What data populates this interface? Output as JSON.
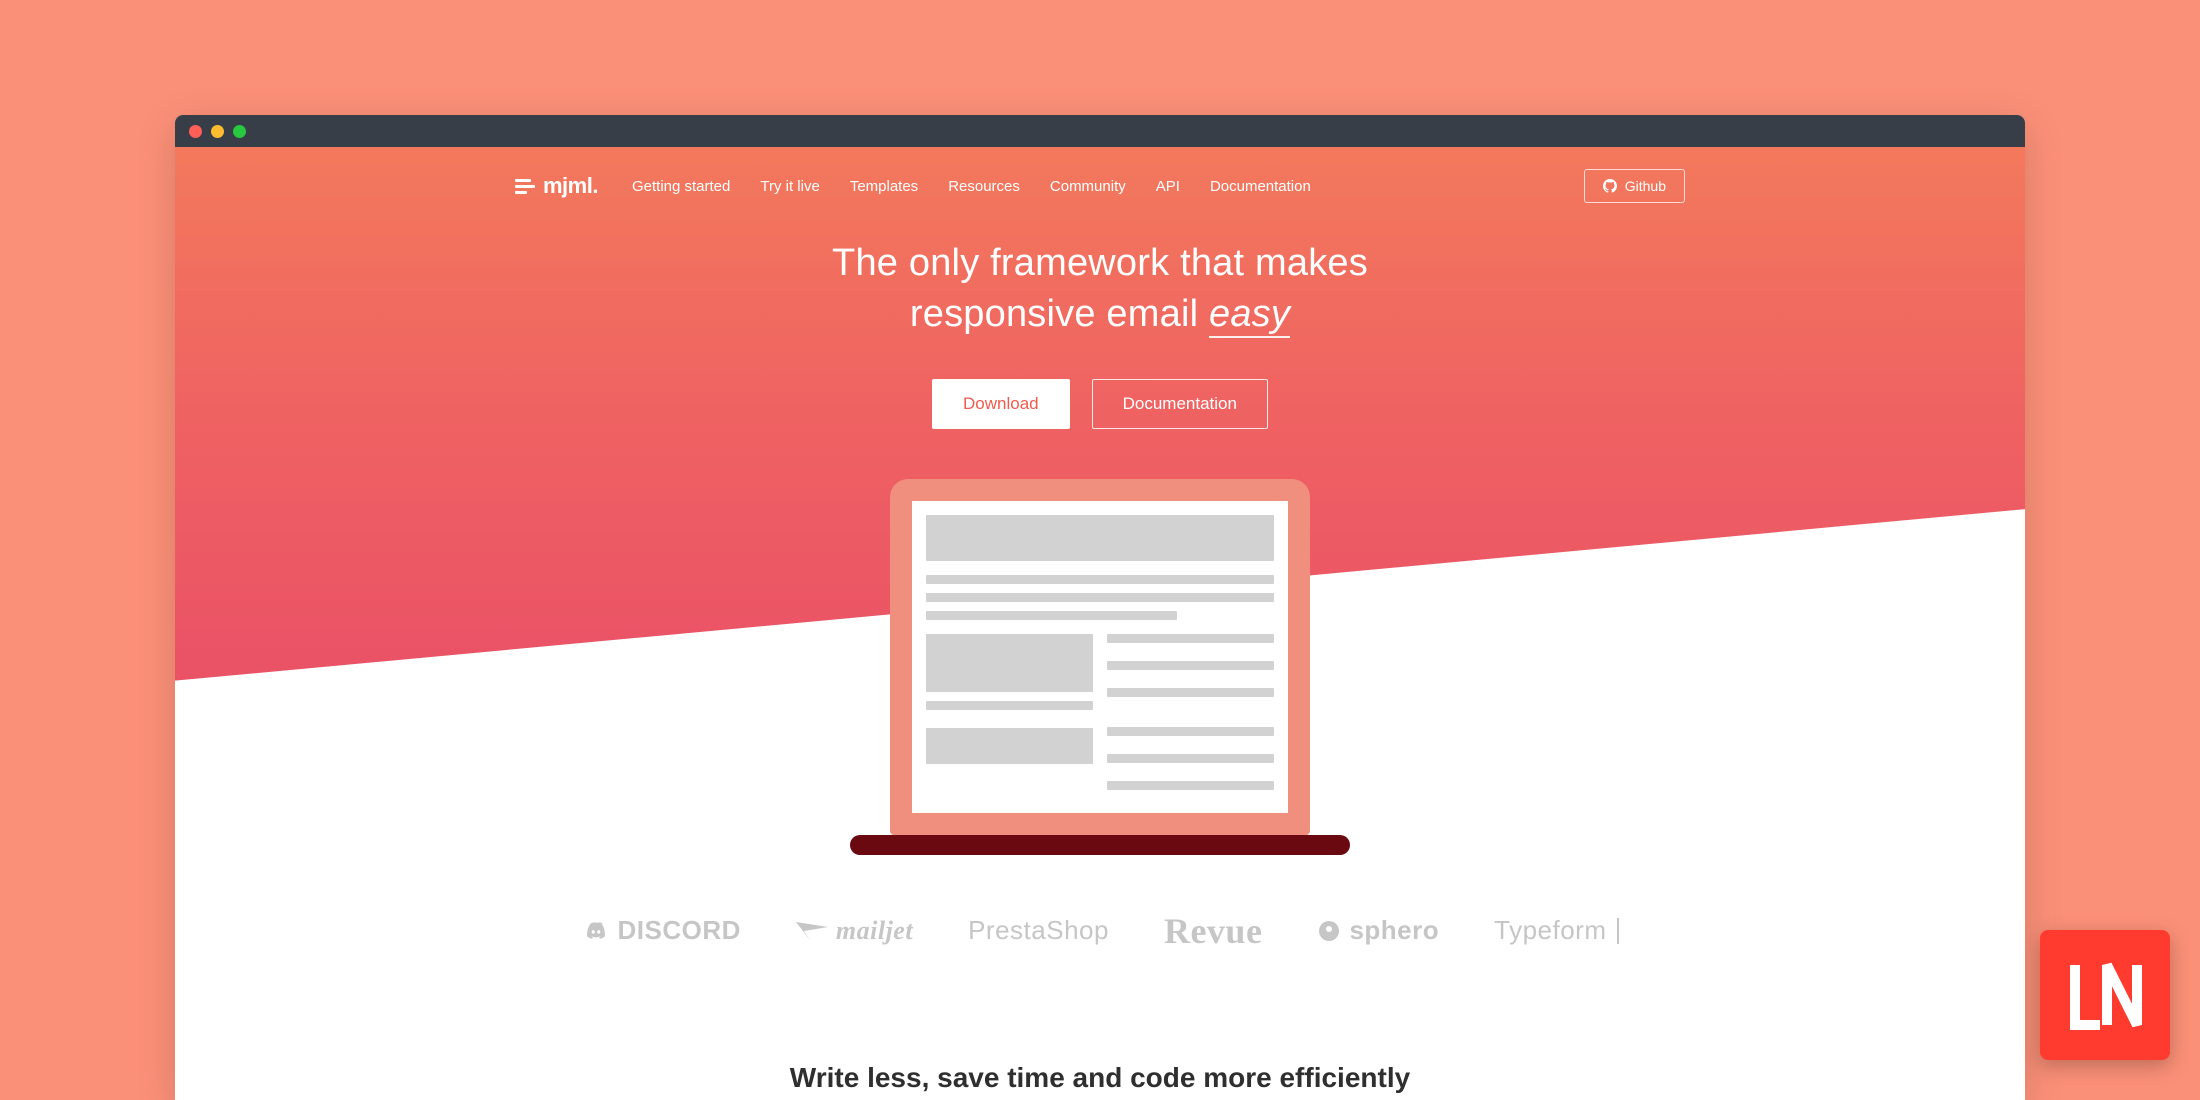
{
  "brand": {
    "name": "mjml."
  },
  "nav": {
    "items": [
      {
        "label": "Getting started"
      },
      {
        "label": "Try it live"
      },
      {
        "label": "Templates"
      },
      {
        "label": "Resources"
      },
      {
        "label": "Community"
      },
      {
        "label": "API"
      },
      {
        "label": "Documentation"
      }
    ],
    "github_label": "Github"
  },
  "hero": {
    "headline_part1": "The only framework that makes",
    "headline_part2a": "responsive email ",
    "headline_part2b": "easy",
    "cta_primary": "Download",
    "cta_secondary": "Documentation"
  },
  "brands": [
    {
      "name": "DISCORD"
    },
    {
      "name": "mailjet"
    },
    {
      "name": "PrestaShop"
    },
    {
      "name": "Revue"
    },
    {
      "name": "sphero"
    },
    {
      "name": "Typeform"
    }
  ],
  "tagline": "Write less, save time and code more efficiently",
  "corner_badge": "LN"
}
